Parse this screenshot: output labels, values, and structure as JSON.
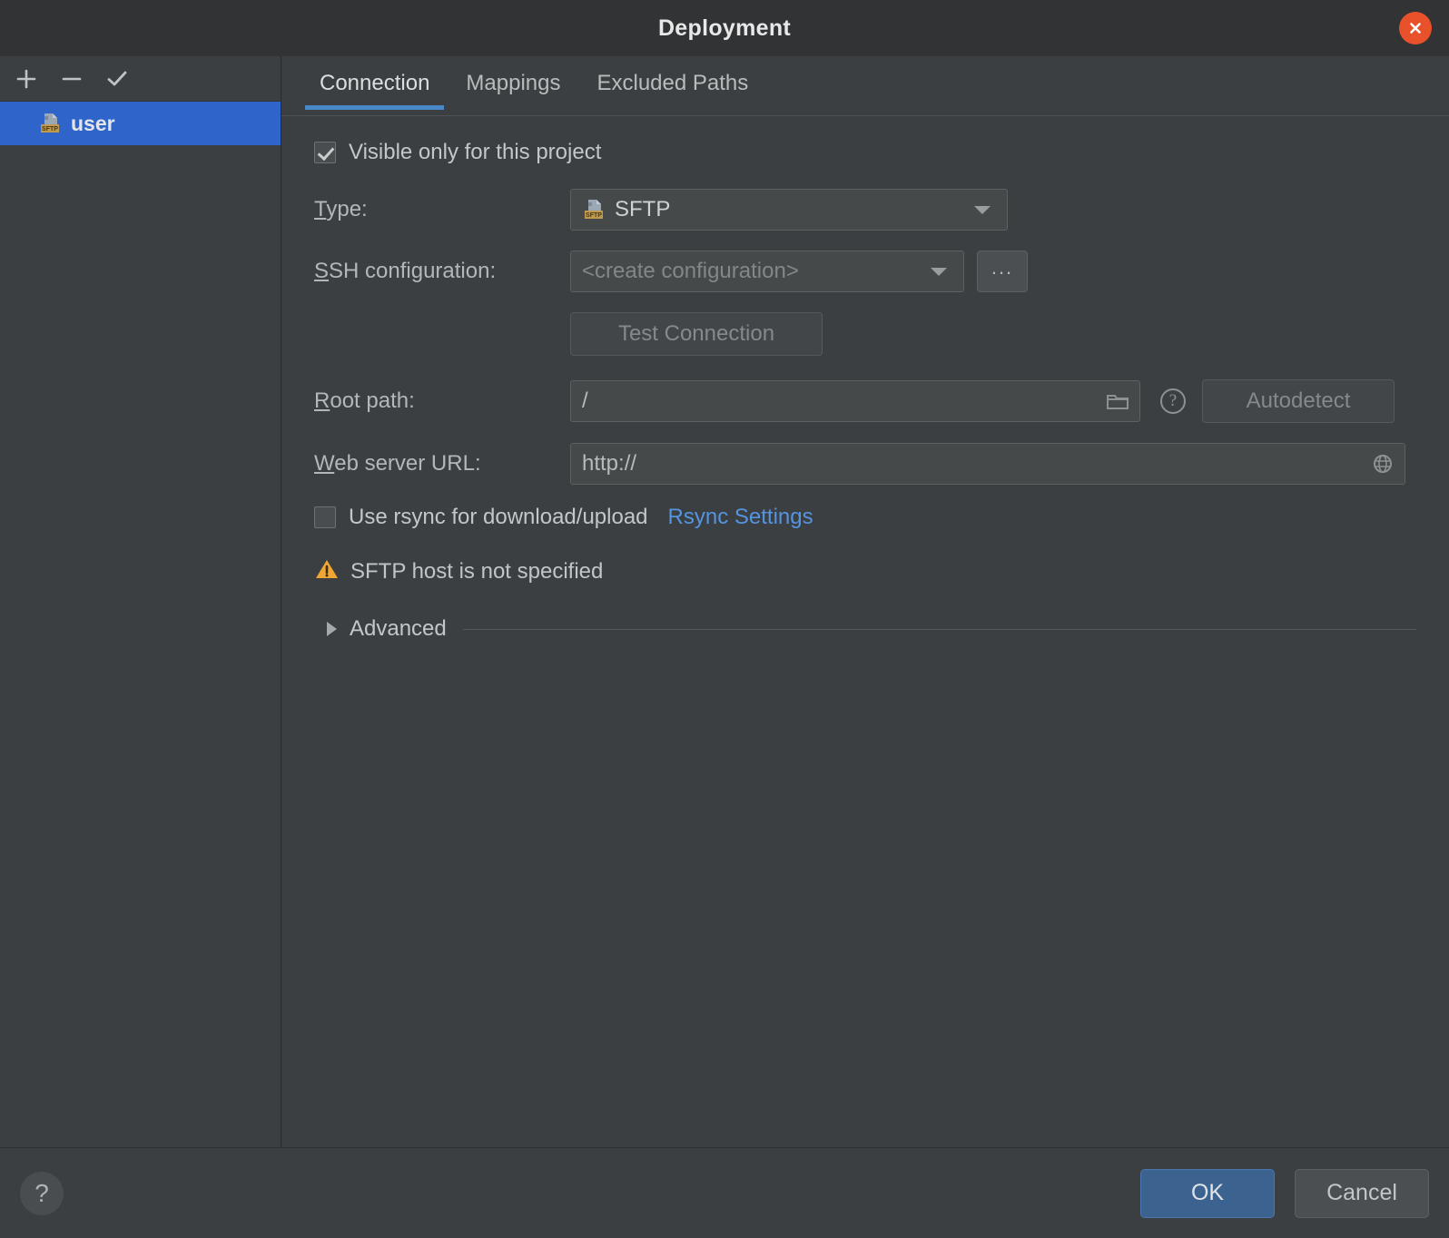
{
  "window": {
    "title": "Deployment",
    "close_label": "×"
  },
  "sidebar": {
    "toolbar": [
      {
        "name": "add",
        "label": "+"
      },
      {
        "name": "remove",
        "label": "−"
      },
      {
        "name": "use-as-default",
        "label": "✓"
      }
    ],
    "servers": [
      {
        "label": "user",
        "icon": "sftp-server-icon",
        "selected": true
      }
    ]
  },
  "tabs": [
    {
      "label": "Connection",
      "active": true
    },
    {
      "label": "Mappings",
      "active": false
    },
    {
      "label": "Excluded Paths",
      "active": false
    }
  ],
  "connection": {
    "visible_only_checkbox": {
      "label": "Visible only for this project",
      "checked": true
    },
    "type": {
      "label": "Type:",
      "mnemonic": "T",
      "value": "SFTP",
      "icon": "sftp-icon"
    },
    "ssh_configuration": {
      "label": "SSH configuration:",
      "mnemonic": "S",
      "value": "<create configuration>",
      "disabled": true,
      "browse_label": "..."
    },
    "test_connection": {
      "label": "Test Connection",
      "disabled": true
    },
    "root_path": {
      "label": "Root path:",
      "mnemonic": "R",
      "value": "/",
      "browse_icon": "folder-icon",
      "help_icon": "question-mark-icon",
      "autodetect_label": "Autodetect",
      "autodetect_disabled": true
    },
    "web_server_url": {
      "label": "Web server URL:",
      "mnemonic": "W",
      "value": "http://",
      "open_icon": "globe-icon"
    },
    "rsync": {
      "checkbox_label": "Use rsync for download/upload",
      "checked": false,
      "settings_link": "Rsync Settings",
      "link_color": "#5494e0"
    },
    "warning": {
      "icon": "warning-triangle-icon",
      "text": "SFTP host is not specified",
      "color": "#f0a732"
    },
    "advanced": {
      "label": "Advanced",
      "expanded": false
    }
  },
  "footer": {
    "help_label": "?",
    "ok_label": "OK",
    "cancel_label": "Cancel"
  },
  "colors": {
    "dialog_bg": "#3c3f41",
    "titlebar_bg": "#313335",
    "selection_blue": "#2f65ca",
    "tab_underline": "#4a88c7",
    "close_orange": "#e8512a",
    "ok_blue": "#3c6390"
  }
}
